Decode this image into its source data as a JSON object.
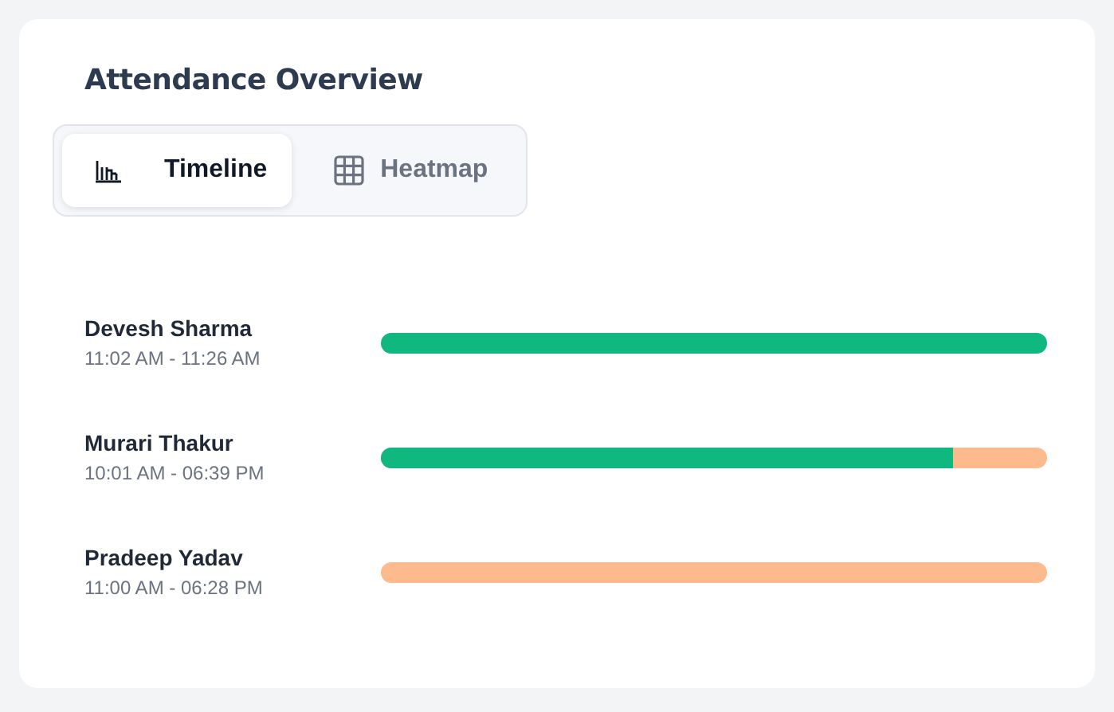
{
  "title": "Attendance Overview",
  "tabs": [
    {
      "label": "Timeline",
      "kind": "timeline",
      "selected": true
    },
    {
      "label": "Heatmap",
      "kind": "heatmap",
      "selected": false
    }
  ],
  "rows": [
    {
      "name": "Devesh Sharma",
      "time": "11:02 AM - 11:26 AM",
      "level": 1
    },
    {
      "name": "Murari Thakur",
      "time": "10:01 AM - 06:39 PM",
      "level": 0.86
    },
    {
      "name": "Pradeep Yadav",
      "time": "11:00 AM - 06:28 PM",
      "level": 0
    }
  ]
}
